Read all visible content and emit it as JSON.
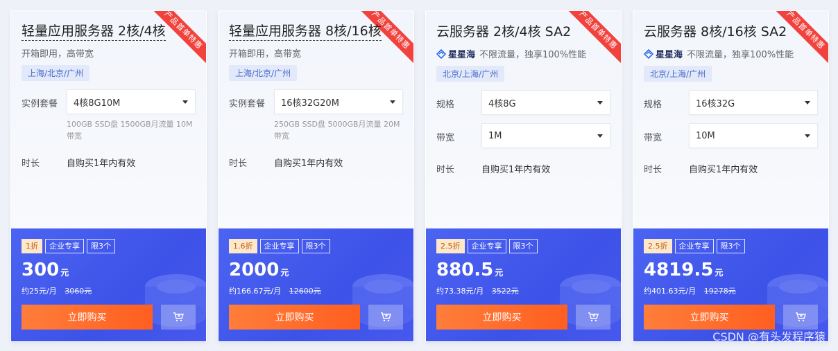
{
  "cards": [
    {
      "ribbon": "产品首单特惠",
      "title": "轻量应用服务器 2核/4核",
      "subtitle": "开箱即用，高带宽",
      "tag": "上海/北京/广州",
      "spec_label": "实例套餐",
      "spec_value": "4核8G10M",
      "spec_desc": "100GB SSD盘 1500GB月流量 10M带宽",
      "duration_label": "时长",
      "duration_value": "自购买1年内有效",
      "discount": "1折",
      "badge_enterprise": "企业专享",
      "badge_limit": "限3个",
      "price": "300",
      "price_unit": "元",
      "monthly": "约25元/月",
      "original": "3060元",
      "buy_label": "立即购买"
    },
    {
      "ribbon": "产品首单特惠",
      "title": "轻量应用服务器 8核/16核",
      "subtitle": "开箱即用，高带宽",
      "tag": "上海/北京/广州",
      "spec_label": "实例套餐",
      "spec_value": "16核32G20M",
      "spec_desc": "250GB SSD盘 5000GB月流量 20M带宽",
      "duration_label": "时长",
      "duration_value": "自购买1年内有效",
      "discount": "1.6折",
      "badge_enterprise": "企业专享",
      "badge_limit": "限3个",
      "price": "2000",
      "price_unit": "元",
      "monthly": "约166.67元/月",
      "original": "12600元",
      "buy_label": "立即购买"
    },
    {
      "ribbon": "产品首单特惠",
      "title": "云服务器 2核/4核 SA2",
      "brand": "星星海",
      "subtitle": "不限流量，独享100%性能",
      "tag": "北京/上海/广州",
      "spec_label": "规格",
      "spec_value": "4核8G",
      "bw_label": "带宽",
      "bw_value": "1M",
      "duration_label": "时长",
      "duration_value": "自购买1年内有效",
      "discount": "2.5折",
      "badge_enterprise": "企业专享",
      "badge_limit": "限3个",
      "price": "880.5",
      "price_unit": "元",
      "monthly": "约73.38元/月",
      "original": "3522元",
      "buy_label": "立即购买"
    },
    {
      "ribbon": "产品首单特惠",
      "title": "云服务器 8核/16核 SA2",
      "brand": "星星海",
      "subtitle": "不限流量，独享100%性能",
      "tag": "北京/上海/广州",
      "spec_label": "规格",
      "spec_value": "16核32G",
      "bw_label": "带宽",
      "bw_value": "10M",
      "duration_label": "时长",
      "duration_value": "自购买1年内有效",
      "discount": "2.5折",
      "badge_enterprise": "企业专享",
      "badge_limit": "限3个",
      "price": "4819.5",
      "price_unit": "元",
      "monthly": "约401.63元/月",
      "original": "19278元",
      "buy_label": "立即购买"
    }
  ],
  "watermark": "CSDN @有头发程序猿",
  "colors": {
    "ribbon": "#f2423d",
    "panel": "#4c64f2",
    "buy": "#ff6a2b",
    "tag_bg": "#e2e9fb",
    "discount_bg": "#fde9c9"
  },
  "icons": {
    "cart": "cart-icon",
    "caret": "chevron-down-icon",
    "brand": "star-logo-icon"
  }
}
